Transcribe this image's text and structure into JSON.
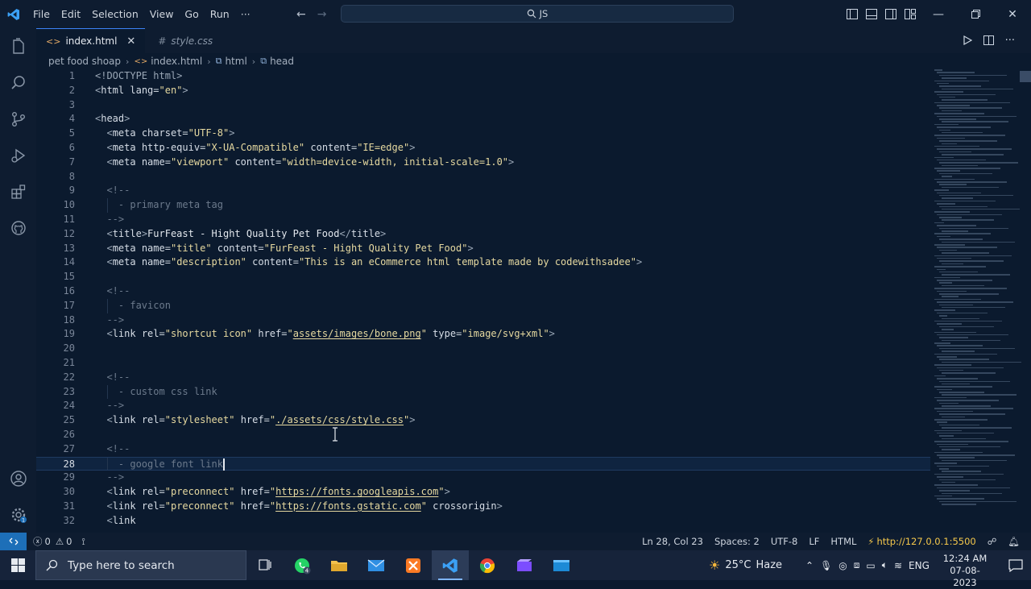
{
  "window": {
    "menu": [
      "File",
      "Edit",
      "Selection",
      "View",
      "Go",
      "Run",
      "···"
    ],
    "command_center": "JS"
  },
  "tabs": [
    {
      "label": "index.html",
      "active": true,
      "icon": "code-brackets-icon"
    },
    {
      "label": "style.css",
      "active": false,
      "icon": "hash-icon"
    }
  ],
  "breadcrumb": [
    "pet food shoap",
    "index.html",
    "html",
    "head"
  ],
  "editor": {
    "lines": [
      {
        "n": "1",
        "html": "<span class=\"t\">&lt;!DOCTYPE html&gt;</span>"
      },
      {
        "n": "2",
        "html": "<span class=\"t\">&lt;</span><span class=\"tn\">html</span> <span class=\"an\">lang</span>=<span class=\"av\">\"en\"</span><span class=\"t\">&gt;</span>"
      },
      {
        "n": "3",
        "html": ""
      },
      {
        "n": "4",
        "html": "<span class=\"t\">&lt;</span><span class=\"tn\">head</span><span class=\"t\">&gt;</span>"
      },
      {
        "n": "5",
        "html": "  <span class=\"t\">&lt;</span><span class=\"tn\">meta</span> <span class=\"an\">charset</span>=<span class=\"av\">\"UTF-8\"</span><span class=\"t\">&gt;</span>"
      },
      {
        "n": "6",
        "html": "  <span class=\"t\">&lt;</span><span class=\"tn\">meta</span> <span class=\"an\">http-equiv</span>=<span class=\"av\">\"X-UA-Compatible\"</span> <span class=\"an\">content</span>=<span class=\"av\">\"IE=edge\"</span><span class=\"t\">&gt;</span>"
      },
      {
        "n": "7",
        "html": "  <span class=\"t\">&lt;</span><span class=\"tn\">meta</span> <span class=\"an\">name</span>=<span class=\"av\">\"viewport\"</span> <span class=\"an\">content</span>=<span class=\"av\">\"width=device-width, initial-scale=1.0\"</span><span class=\"t\">&gt;</span>"
      },
      {
        "n": "8",
        "html": ""
      },
      {
        "n": "9",
        "html": "  <span class=\"cm\">&lt;!--</span>"
      },
      {
        "n": "10",
        "html": "    <span class=\"cm\">- primary meta tag</span>"
      },
      {
        "n": "11",
        "html": "  <span class=\"cm\">--&gt;</span>"
      },
      {
        "n": "12",
        "html": "  <span class=\"t\">&lt;</span><span class=\"tn\">title</span><span class=\"t\">&gt;</span><span class=\"tx\">FurFeast - Hight Quality Pet Food</span><span class=\"t\">&lt;/</span><span class=\"tn\">title</span><span class=\"t\">&gt;</span>"
      },
      {
        "n": "13",
        "html": "  <span class=\"t\">&lt;</span><span class=\"tn\">meta</span> <span class=\"an\">name</span>=<span class=\"av\">\"title\"</span> <span class=\"an\">content</span>=<span class=\"av\">\"FurFeast - Hight Quality Pet Food\"</span><span class=\"t\">&gt;</span>"
      },
      {
        "n": "14",
        "html": "  <span class=\"t\">&lt;</span><span class=\"tn\">meta</span> <span class=\"an\">name</span>=<span class=\"av\">\"description\"</span> <span class=\"an\">content</span>=<span class=\"av\">\"This is an eCommerce html template made by codewithsadee\"</span><span class=\"t\">&gt;</span>"
      },
      {
        "n": "15",
        "html": ""
      },
      {
        "n": "16",
        "html": "  <span class=\"cm\">&lt;!--</span>"
      },
      {
        "n": "17",
        "html": "    <span class=\"cm\">- favicon</span>"
      },
      {
        "n": "18",
        "html": "  <span class=\"cm\">--&gt;</span>"
      },
      {
        "n": "19",
        "html": "  <span class=\"t\">&lt;</span><span class=\"tn\">link</span> <span class=\"an\">rel</span>=<span class=\"av\">\"shortcut icon\"</span> <span class=\"an\">href</span>=<span class=\"av\">\"</span><span class=\"lk\">assets/images/bone.png</span><span class=\"av\">\"</span> <span class=\"an\">type</span>=<span class=\"av\">\"image/svg+xml\"</span><span class=\"t\">&gt;</span>"
      },
      {
        "n": "20",
        "html": ""
      },
      {
        "n": "21",
        "html": ""
      },
      {
        "n": "22",
        "html": "  <span class=\"cm\">&lt;!--</span>"
      },
      {
        "n": "23",
        "html": "    <span class=\"cm\">- custom css link</span>"
      },
      {
        "n": "24",
        "html": "  <span class=\"cm\">--&gt;</span>"
      },
      {
        "n": "25",
        "html": "  <span class=\"t\">&lt;</span><span class=\"tn\">link</span> <span class=\"an\">rel</span>=<span class=\"av\">\"stylesheet\"</span> <span class=\"an\">href</span>=<span class=\"av\">\"</span><span class=\"lk\">./assets/css/style.css</span><span class=\"av\">\"</span><span class=\"t\">&gt;</span>"
      },
      {
        "n": "26",
        "html": ""
      },
      {
        "n": "27",
        "html": "  <span class=\"cm\">&lt;!--</span>"
      },
      {
        "n": "28",
        "html": "    <span class=\"cm\">- google font link</span><span class=\"cursor\"></span>",
        "current": true
      },
      {
        "n": "29",
        "html": "  <span class=\"cm\">--&gt;</span>"
      },
      {
        "n": "30",
        "html": "  <span class=\"t\">&lt;</span><span class=\"tn\">link</span> <span class=\"an\">rel</span>=<span class=\"av\">\"preconnect\"</span> <span class=\"an\">href</span>=<span class=\"av\">\"</span><span class=\"lk\">https://fonts.googleapis.com</span><span class=\"av\">\"</span><span class=\"t\">&gt;</span>"
      },
      {
        "n": "31",
        "html": "  <span class=\"t\">&lt;</span><span class=\"tn\">link</span> <span class=\"an\">rel</span>=<span class=\"av\">\"preconnect\"</span> <span class=\"an\">href</span>=<span class=\"av\">\"</span><span class=\"lk\">https://fonts.gstatic.com</span><span class=\"av\">\"</span> <span class=\"an\">crossorigin</span><span class=\"t\">&gt;</span>"
      },
      {
        "n": "32",
        "html": "  <span class=\"t\">&lt;</span><span class=\"tn\">link</span>"
      }
    ]
  },
  "statusbar": {
    "errors": "0",
    "warnings": "0",
    "position": "Ln 28, Col 23",
    "spaces": "Spaces: 2",
    "encoding": "UTF-8",
    "eol": "LF",
    "language": "HTML",
    "live_server": "http://127.0.0.1:5500"
  },
  "taskbar": {
    "search_placeholder": "Type here to search",
    "whatsapp_badge": "4",
    "weather_temp": "25°C",
    "weather_desc": "Haze",
    "lang": "ENG",
    "time": "12:24 AM",
    "date": "07-08-2023"
  },
  "colors": {
    "accent": "#3b82f6",
    "editor_bg": "#0b1a2e",
    "remote_bg": "#1d6fb8",
    "live_server": "#f5c84b"
  }
}
